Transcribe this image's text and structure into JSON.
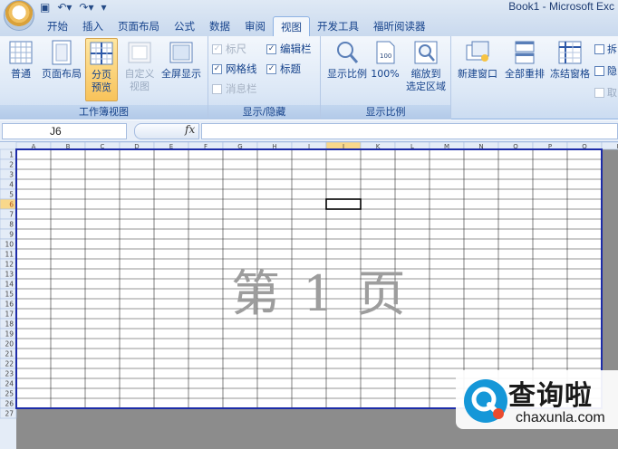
{
  "window": {
    "title": "Book1 - Microsoft Exc"
  },
  "tabs": [
    {
      "label": "开始"
    },
    {
      "label": "插入"
    },
    {
      "label": "页面布局"
    },
    {
      "label": "公式"
    },
    {
      "label": "数据"
    },
    {
      "label": "审阅"
    },
    {
      "label": "视图"
    },
    {
      "label": "开发工具"
    },
    {
      "label": "福昕阅读器"
    }
  ],
  "active_tab": "视图",
  "ribbon": {
    "workbook_views": {
      "label": "工作簿视图",
      "normal": "普通",
      "page_layout": "页面布局",
      "page_break_1": "分页",
      "page_break_2": "预览",
      "custom_1": "自定义",
      "custom_2": "视图",
      "fullscreen": "全屏显示"
    },
    "show_hide": {
      "label": "显示/隐藏",
      "ruler": "标尺",
      "gridlines": "网格线",
      "message_bar": "消息栏",
      "formula_bar": "编辑栏",
      "headings": "标题",
      "check": "✓"
    },
    "zoom": {
      "label": "显示比例",
      "zoom": "显示比例",
      "hundred": "100%",
      "zoom_sel_1": "缩放到",
      "zoom_sel_2": "选定区域"
    },
    "window_group": {
      "new_window": "新建窗口",
      "arrange_all": "全部重排",
      "freeze": "冻结窗格",
      "split": "拆",
      "hide": "隐",
      "unhide": "取"
    }
  },
  "formula_bar": {
    "name_box": "J6",
    "fx": "fx",
    "value": ""
  },
  "sheet": {
    "columns": [
      "A",
      "B",
      "C",
      "D",
      "E",
      "F",
      "G",
      "H",
      "I",
      "J",
      "K",
      "L",
      "M",
      "N",
      "O",
      "P",
      "Q",
      "R"
    ],
    "row_count": 27,
    "selected_cell": "J6",
    "page_watermark": "第 1 页"
  },
  "site_watermark": {
    "name": "查询啦",
    "url": "chaxunla.com"
  }
}
